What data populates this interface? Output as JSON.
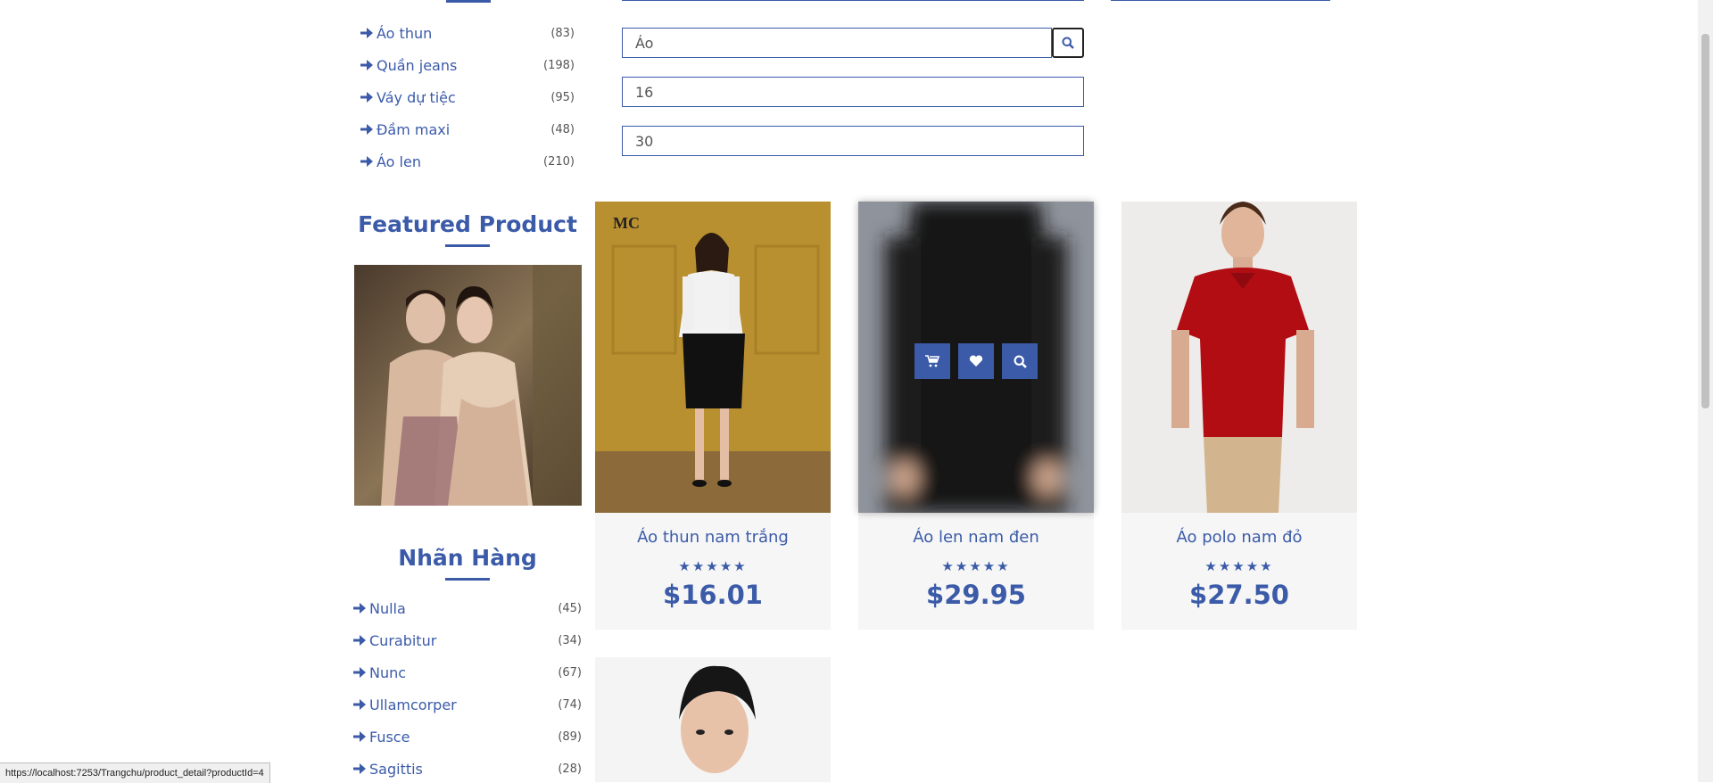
{
  "categories": [
    {
      "label": "Áo thun",
      "count": "(83)"
    },
    {
      "label": "Quần jeans",
      "count": "(198)"
    },
    {
      "label": "Váy dự tiệc",
      "count": "(95)"
    },
    {
      "label": "Đầm maxi",
      "count": "(48)"
    },
    {
      "label": "Áo len",
      "count": "(210)"
    }
  ],
  "search": {
    "keyword": "Áo",
    "min_price": "16",
    "max_price": "30",
    "button_icon": "search-icon"
  },
  "featured": {
    "title": "Featured Product"
  },
  "brands": {
    "title": "Nhãn Hàng",
    "items": [
      {
        "label": "Nulla",
        "count": "(45)"
      },
      {
        "label": "Curabitur",
        "count": "(34)"
      },
      {
        "label": "Nunc",
        "count": "(67)"
      },
      {
        "label": "Ullamcorper",
        "count": "(74)"
      },
      {
        "label": "Fusce",
        "count": "(89)"
      },
      {
        "label": "Sagittis",
        "count": "(28)"
      }
    ]
  },
  "products": [
    {
      "name": "Áo thun nam trắng",
      "stars": "★★★★★",
      "price": "$16.01"
    },
    {
      "name": "Áo len nam đen",
      "stars": "★★★★★",
      "price": "$29.95"
    },
    {
      "name": "Áo polo nam đỏ",
      "stars": "★★★★★",
      "price": "$27.50"
    }
  ],
  "hover_actions": [
    "cart-icon",
    "heart-icon",
    "search-icon"
  ],
  "status_bar": "https://localhost:7253/Trangchu/product_detail?productId=4",
  "colors": {
    "accent": "#3b5ba9",
    "card_bg": "#f6f6f6"
  }
}
